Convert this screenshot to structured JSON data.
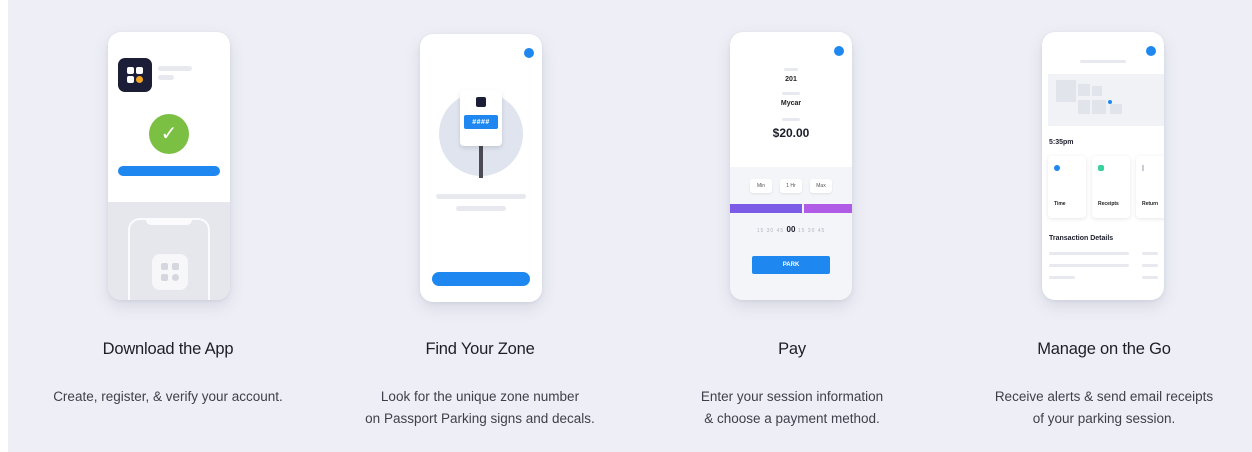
{
  "steps": [
    {
      "title": "Download the App",
      "description_line1": "Create, register, & verify your account.",
      "description_line2": ""
    },
    {
      "title": "Find Your Zone",
      "description_line1": "Look for the unique zone number",
      "description_line2": "on Passport Parking signs and decals."
    },
    {
      "title": "Pay",
      "description_line1": "Enter your session information",
      "description_line2": "& choose a payment method."
    },
    {
      "title": "Manage on the Go",
      "description_line1": "Receive alerts & send email receipts",
      "description_line2": "of your parking session."
    }
  ],
  "phone_find_zone": {
    "zone_number": "####"
  },
  "phone_pay": {
    "zone": "201",
    "vehicle": "Mycar",
    "amount": "$20.00",
    "chip_labels": [
      "Min",
      "1 Hr",
      "Max"
    ],
    "time_picker_left": "15  30  45",
    "time_picker_selected": "00",
    "time_picker_right": "15  30  45",
    "park_button": "PARK"
  },
  "phone_manage": {
    "time": "5:35pm",
    "cards": [
      "Time",
      "Receipts",
      "Return"
    ],
    "section_title": "Transaction Details"
  },
  "colors": {
    "background": "#eeeff6",
    "accent_blue": "#1e88f0",
    "success_green": "#7bc043",
    "purple": "#7c5ce6",
    "violet": "#b15ce6",
    "dark_navy": "#1c1d36"
  },
  "icons": {
    "app_logo": "app-logo-icon",
    "check": "checkmark-icon",
    "sign": "zone-sign-icon"
  }
}
